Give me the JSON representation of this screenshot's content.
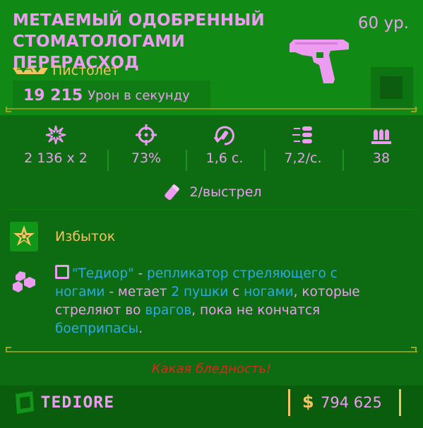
{
  "item": {
    "title": "МЕТАЕМЫЙ ОДОБРЕННЫЙ СТОМАТОЛОГАМИ ПЕРЕРАСХОД",
    "level": "60 ур.",
    "weapon_type": "Пистолет",
    "dps_value": "19 215",
    "dps_label": "Урон в секунду",
    "rarity_icon": "rarity-chevrons-icon",
    "weapon_icon": "pistol-icon"
  },
  "stats": [
    {
      "icon": "damage-burst-icon",
      "value": "2 136 x 2"
    },
    {
      "icon": "crosshair-icon",
      "value": "73%"
    },
    {
      "icon": "reload-icon",
      "value": "1,6 с."
    },
    {
      "icon": "fire-rate-icon",
      "value": "7,2/с."
    },
    {
      "icon": "magazine-icon",
      "value": "38"
    }
  ],
  "ammo": {
    "icon": "ammo-cost-icon",
    "text": "2/выстрел"
  },
  "perks": [
    {
      "icon": "gold-star-icon",
      "label": "Избыток"
    },
    {
      "icon": "hexagon-cluster-icon",
      "segments": [
        {
          "text": "\"Тедиор\"",
          "style": "blue"
        },
        {
          "text": " - ",
          "style": "plain"
        },
        {
          "text": "репликатор стреляющего с ногами",
          "style": "blue"
        },
        {
          "text": " - метает ",
          "style": "plain"
        },
        {
          "text": "2 пушки",
          "style": "blue"
        },
        {
          "text": " с ",
          "style": "plain"
        },
        {
          "text": "ногами",
          "style": "blue"
        },
        {
          "text": ", которые стреляют во ",
          "style": "plain"
        },
        {
          "text": "врагов",
          "style": "blue"
        },
        {
          "text": ", пока не кончатся ",
          "style": "plain"
        },
        {
          "text": "боеприпасы",
          "style": "blue"
        },
        {
          "text": ".",
          "style": "plain"
        }
      ]
    }
  ],
  "flavor_text": "Какая бледность!",
  "footer": {
    "manufacturer": "TEDIORE",
    "currency_symbol": "$",
    "price": "794 625"
  },
  "colors": {
    "background": "#0d6c11",
    "header": "#118915",
    "primary_text": "#ee9cf2",
    "accent_gold": "#f2c463",
    "link_blue": "#2fa8e8",
    "flavor_red": "#e0261e"
  }
}
